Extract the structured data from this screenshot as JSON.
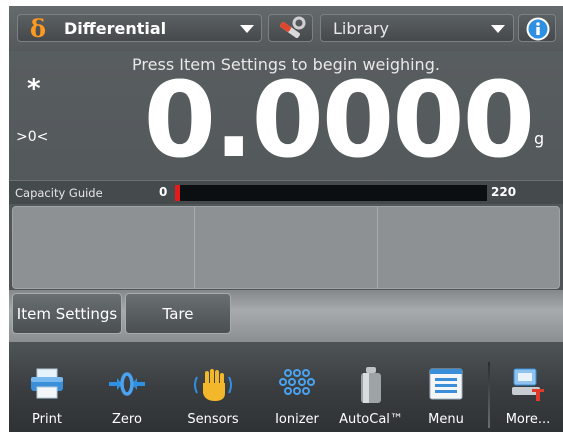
{
  "header": {
    "app_name": "Differential",
    "app_symbol": "δ",
    "library_label": "Library"
  },
  "main": {
    "message": "Press Item Settings to begin weighing.",
    "stable_indicator": "*",
    "center_of_zero": ">0<",
    "weight": "0.0000",
    "unit": "g"
  },
  "capacity_guide": {
    "label": "Capacity Guide",
    "min": "0",
    "max": "220",
    "fill_fraction": 0.0
  },
  "actions": {
    "item_settings": "Item Settings",
    "tare": "Tare"
  },
  "toolbar": {
    "items": [
      {
        "label": "Print",
        "icon": "printer-icon"
      },
      {
        "label": "Zero",
        "icon": "zero-icon"
      },
      {
        "label": "Sensors",
        "icon": "hand-sensor-icon"
      },
      {
        "label": "Ionizer",
        "icon": "ionizer-icon"
      },
      {
        "label": "AutoCal™",
        "icon": "calibration-weight-icon"
      },
      {
        "label": "Menu",
        "icon": "menu-icon"
      },
      {
        "label": "More...",
        "icon": "more-icon"
      }
    ]
  },
  "colors": {
    "delta_orange": "#ff9a1f",
    "capacity_red": "#e31b1b",
    "icon_blue": "#2f8fe0"
  }
}
